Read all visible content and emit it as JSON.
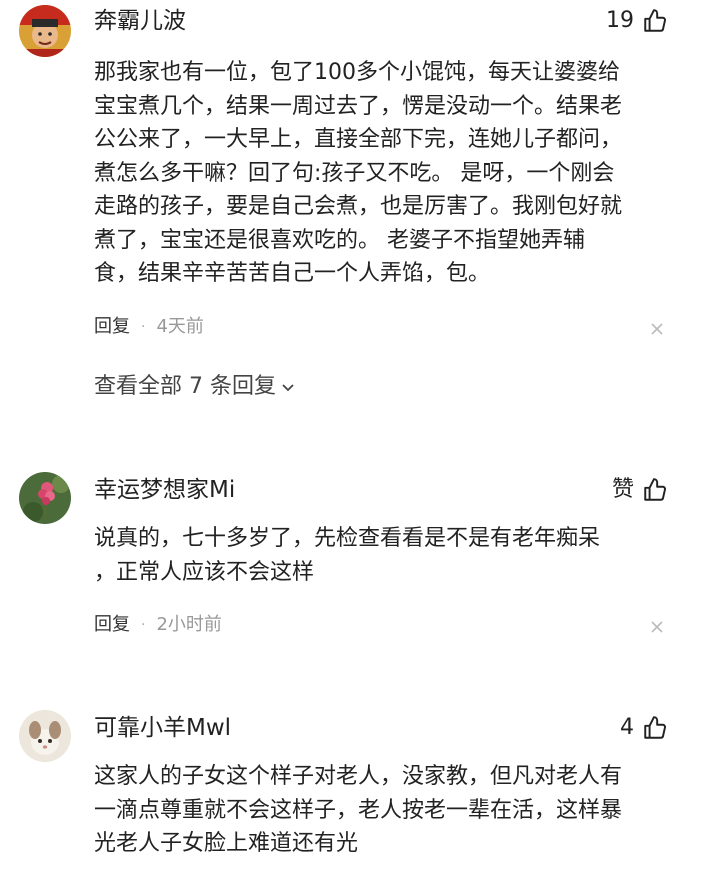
{
  "comments": [
    {
      "username": "奔霸儿波",
      "likes": "19",
      "lines": [
        "那我家也有一位，包了100多个小馄饨，每天让婆婆给",
        "宝宝煮几个，结果一周过去了，愣是没动一个。结果老",
        "公公来了，一大早上，直接全部下完，连她儿子都问，",
        "煮怎么多干嘛？回了句:孩子又不吃。 是呀，一个刚会",
        "走路的孩子，要是自己会煮，也是厉害了。我刚包好就",
        "煮了，宝宝还是很喜欢吃的。 老婆子不指望她弄辅",
        "食，结果辛辛苦苦自己一个人弄馅，包。"
      ],
      "reply_label": "回复",
      "dot": "·",
      "time": "4天前",
      "view_all_label": "查看全部 7 条回复"
    },
    {
      "username": "幸运梦想家Mi",
      "likes": "赞",
      "lines": [
        "说真的，七十多岁了，先检查看看是不是有老年痴呆",
        "，正常人应该不会这样"
      ],
      "reply_label": "回复",
      "dot": "·",
      "time": "2小时前"
    },
    {
      "username": "可靠小羊Mwl",
      "likes": "4",
      "lines": [
        "这家人的子女这个样子对老人，没家教，但凡对老人有",
        "一滴点尊重就不会这样子，老人按老一辈在活，这样暴",
        "光老人子女脸上难道还有光"
      ]
    }
  ],
  "icons": {
    "like": "thumbs-up-icon",
    "close": "close-icon",
    "expand": "chevron-down-icon"
  }
}
